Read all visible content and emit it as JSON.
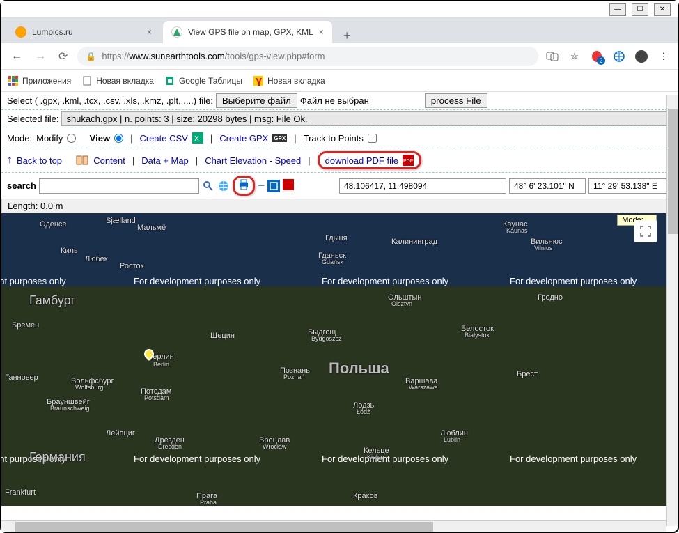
{
  "window": {
    "minimize": "—",
    "maximize": "☐",
    "close": "✕"
  },
  "tabs": {
    "tab1_title": "Lumpics.ru",
    "tab2_title": "View GPS file on map, GPX, KML",
    "new_tab": "+"
  },
  "nav": {
    "back": "←",
    "forward": "→",
    "reload": "⟳"
  },
  "url": {
    "lock": "🔒",
    "protocol": "https://",
    "host": "www.sunearthtools.com",
    "path": "/tools/gps-view.php#form"
  },
  "ext": {
    "translate": "🌐",
    "star": "☆",
    "badge": "2",
    "menu": "⋮"
  },
  "bookmarks": {
    "apps": "Приложения",
    "bm1": "Новая вкладка",
    "bm2": "Google Таблицы",
    "bm3": "Новая вкладка"
  },
  "file_row": {
    "label": "Select ( .gpx, .kml, .tcx, .csv, .xls, .kmz, .plt, ....) file:",
    "choose_btn": "Выберите файл",
    "no_file": "Файл не выбран",
    "process_btn": "process File"
  },
  "selected": {
    "label": "Selected file:",
    "info": "shukach.gpx    | n. points: 3 | size: 20298 bytes | msg: File Ok."
  },
  "mode_row": {
    "mode_label": "Mode:",
    "modify": "Modify",
    "view": "View",
    "create_csv": "Create CSV",
    "create_gpx": "Create GPX",
    "gpx_badge": "GPX",
    "track_to_points": "Track to Points"
  },
  "links": {
    "back_to_top": "Back to top",
    "content": "Content",
    "data_map": "Data + Map",
    "chart": "Chart Elevation - Speed",
    "download_pdf": "download PDF file"
  },
  "search": {
    "label": "search",
    "coord1": "48.106417, 11.498094",
    "coord2_a": "48° 6' 23.101\" N",
    "coord2_b": "11° 29' 53.138\" E"
  },
  "length": {
    "label": "Length: 0.0 m"
  },
  "map": {
    "mode_badge": "Mode: ...",
    "dev_text": "For development purposes only",
    "dev_text_partial": "ent purposes only",
    "country_poland": "Польша",
    "country_germany": "Германия",
    "cities": {
      "odense": "Оденсе",
      "sjaelland": "Sjælland",
      "malmo": "Мальмё",
      "kiel": "Киль",
      "lubeck": "Любек",
      "rostock": "Росток",
      "hamburg": "Гамбург",
      "bremen": "Бремен",
      "szczecin": "Щецин",
      "berlin": "Берлин",
      "berlin_en": "Berlin",
      "hannover": "Ганновер",
      "wolfsburg": "Вольфсбург",
      "wolfsburg_en": "Wolfsburg",
      "braunschweig": "Брауншвейг",
      "braunschweig_en": "Braunschweig",
      "potsdam": "Потсдам",
      "potsdam_en": "Potsdam",
      "leipzig": "Лейпциг",
      "dresden": "Дрезден",
      "dresden_en": "Dresden",
      "frankfurt": "Frankfurt",
      "praha": "Прага",
      "praha_en": "Praha",
      "gdynia": "Гдыня",
      "gdansk": "Гданьск",
      "gdansk_en": "Gdańsk",
      "bydgoszcz": "Быдгощ",
      "bydgoszcz_en": "Bydgoszcz",
      "poznan": "Познань",
      "poznan_en": "Poznań",
      "wroclaw": "Вроцлав",
      "wroclaw_en": "Wrocław",
      "lodz": "Лодзь",
      "lodz_en": "Łódź",
      "warsaw": "Варшава",
      "warsaw_en": "Warszawa",
      "krakow": "Краков",
      "kaliningrad": "Калининград",
      "olsztyn": "Ольштын",
      "olsztyn_en": "Olsztyn",
      "bialystok": "Белосток",
      "bialystok_en": "Białystok",
      "lublin": "Люблин",
      "lublin_en": "Lublin",
      "kielce": "Кельце",
      "kielce_en": "Kielce",
      "kaunas": "Каунас",
      "kaunas_en": "Kaunas",
      "vilnius": "Вильнюс",
      "vilnius_en": "Vilnius",
      "grodno": "Гродно",
      "brest": "Брест"
    }
  }
}
